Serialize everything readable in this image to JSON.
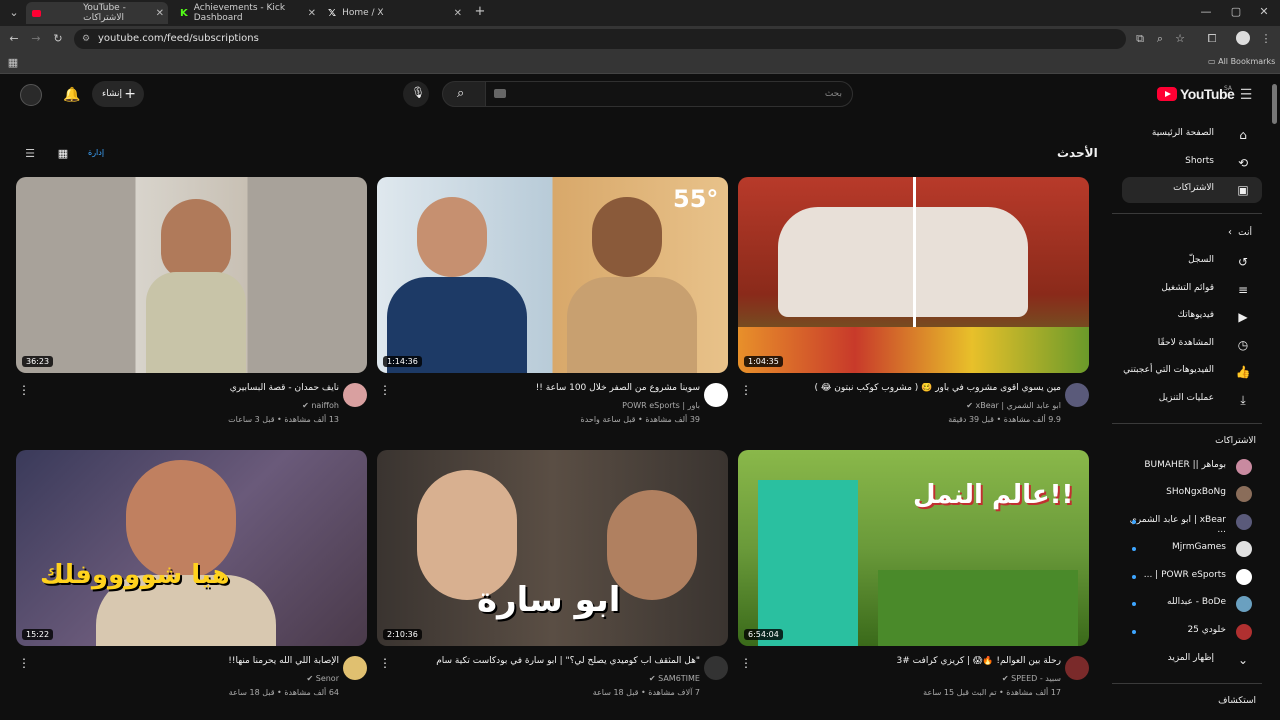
{
  "browser": {
    "tabs": [
      {
        "label": "YouTube - الاشتراكات",
        "active": true
      },
      {
        "label": "Achievements - Kick Dashboard",
        "active": false
      },
      {
        "label": "Home / X",
        "active": false
      }
    ],
    "new_tab": "+",
    "url": "youtube.com/feed/subscriptions",
    "bookmarks_label": "All Bookmarks"
  },
  "header": {
    "logo_text": "YouTube",
    "logo_region": "SA",
    "search_placeholder": "بحث",
    "create_label": "إنشاء"
  },
  "sidebar": {
    "main": [
      {
        "label": "الصفحة الرئيسية",
        "icon": "home-icon"
      },
      {
        "label": "Shorts",
        "icon": "shorts-icon"
      },
      {
        "label": "الاشتراكات",
        "icon": "subscriptions-icon",
        "active": true
      }
    ],
    "you_heading": "أنت",
    "you": [
      {
        "label": "السجلّ",
        "icon": "history-icon"
      },
      {
        "label": "قوائم التشغيل",
        "icon": "playlists-icon"
      },
      {
        "label": "فيديوهاتك",
        "icon": "your-videos-icon"
      },
      {
        "label": "المشاهدة لاحقًا",
        "icon": "watch-later-icon"
      },
      {
        "label": "الفيديوهات التي أعجبتني",
        "icon": "liked-icon"
      },
      {
        "label": "عمليات التنزيل",
        "icon": "download-icon"
      }
    ],
    "subs_heading": "الاشتراكات",
    "subs": [
      {
        "label": "بوماهر || BUMAHER",
        "color": "#c98aa0",
        "dot": false
      },
      {
        "label": "SHoNgxBoNg",
        "color": "#8a6d5a",
        "dot": false
      },
      {
        "label": "xBear | ابو عابد الشمري ...",
        "color": "#5a5a7a",
        "dot": true
      },
      {
        "label": "MjrmGames",
        "color": "#e0e0e0",
        "dot": true
      },
      {
        "label": "POWR eSports | ...",
        "color": "#ffffff",
        "dot": true
      },
      {
        "label": "BoDe - عبدالله",
        "color": "#6aa0c0",
        "dot": true
      },
      {
        "label": "خلودي 25",
        "color": "#b03030",
        "dot": true
      }
    ],
    "show_more": "إظهار المزيد",
    "explore_heading": "استكشاف"
  },
  "main": {
    "section_title": "الأحدث",
    "manage_label": "إدارة",
    "videos": [
      {
        "title": "نايف حمدان - قصة البسابيري",
        "channel": "naiffoh",
        "meta": "13 ألف مشاهدة • قبل 3 ساعات",
        "duration": "36:23",
        "bg": "#b8b2a8",
        "avatar": "#d9a0a0"
      },
      {
        "title": "سوينا مشروع من الصفر خلال 100 ساعة !!",
        "channel": "باور | POWR eSports",
        "meta": "39 ألف مشاهدة • قبل ساعة واحدة",
        "duration": "1:14:36",
        "bg": "#9ab6cf",
        "avatar": "#ffffff",
        "overlay": "55°"
      },
      {
        "title": "مين يسوي اقوى مشروب في باور 🥴 ( مشروب كوكب نبتون 😂 )",
        "channel": "ابو عابد الشمري | xBear",
        "meta": "9.9 ألف مشاهدة • قبل 39 دقيقة",
        "duration": "1:04:35",
        "bg": "#c04a2a",
        "avatar": "#5a5a7a"
      },
      {
        "title": "الإصابة اللي الله يحرمنا منها!!",
        "channel": "Senor",
        "meta": "64 ألف مشاهدة • قبل 18 ساعة",
        "duration": "15:22",
        "bg": "#5a4e6a",
        "avatar": "#e0c070",
        "overlay": "هيا شووووفلك"
      },
      {
        "title": "\"هل المثقف اب كوميدي يصلح لي؟\" | ابو سارة في بودكاست تكية سام",
        "channel": "SAM6TIME",
        "meta": "7 آلاف مشاهدة • قبل 18 ساعة",
        "duration": "2:10:36",
        "bg": "#4a4440",
        "avatar": "#333333",
        "overlay": "ابو سارة"
      },
      {
        "title": "رحلة بين العوالم! 🔥😱 | كريزي كرافت #3",
        "channel": "سبيد - SPEED",
        "meta": "17 ألف مشاهدة • تم البث قبل 15 ساعة",
        "duration": "6:54:04",
        "bg": "#5c8a2c",
        "avatar": "#7a2a2a",
        "overlay": "عالم النمل!!"
      }
    ]
  },
  "colors": {
    "accent": "#3ea6ff",
    "brand": "#ff0033",
    "bg": "#0f0f0f"
  }
}
